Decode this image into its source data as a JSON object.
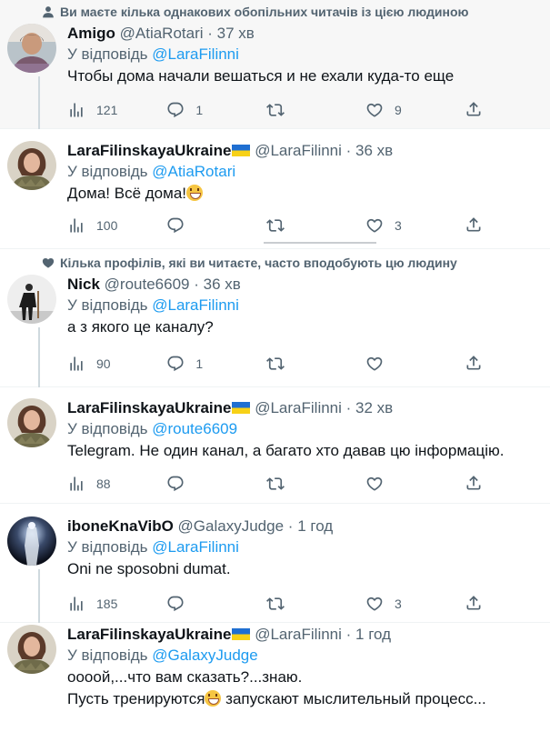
{
  "tweets": [
    {
      "context": "Ви маєте кілька однакових обопільних читачів із цією людиною",
      "name": "Amigo",
      "handle": "@AtiaRotari",
      "time": "37 хв",
      "reply_prefix": "У відповідь",
      "reply_to": "@LaraFilinni",
      "text": "Чтобы дома начали вешаться и не ехали куда-то еще",
      "views": "121",
      "replies": "1",
      "retweets": "",
      "likes": "9"
    },
    {
      "name": "LaraFilinskayaUkraine",
      "handle": "@LaraFilinni",
      "time": "36 хв",
      "reply_prefix": "У відповідь",
      "reply_to": "@AtiaRotari",
      "text": "Дома! Всё дома!",
      "views": "100",
      "replies": "",
      "retweets": "",
      "likes": "3"
    },
    {
      "context": "Кілька профілів, які ви читаєте, часто вподобують цю людину",
      "name": "Nick",
      "handle": "@route6609",
      "time": "36 хв",
      "reply_prefix": "У відповідь",
      "reply_to": "@LaraFilinni",
      "text": "а з якого це каналу?",
      "views": "90",
      "replies": "1",
      "retweets": "",
      "likes": ""
    },
    {
      "name": "LaraFilinskayaUkraine",
      "handle": "@LaraFilinni",
      "time": "32 хв",
      "reply_prefix": "У відповідь",
      "reply_to": "@route6609",
      "text": "Telegram. Не один канал, а багато хто давав цю інформацію.",
      "views": "88",
      "replies": "",
      "retweets": "",
      "likes": ""
    },
    {
      "name": "iboneKnaVibO",
      "handle": "@GalaxyJudge",
      "time": "1 год",
      "reply_prefix": "У відповідь",
      "reply_to": "@LaraFilinni",
      "text": "Oni ne sposobni dumat.",
      "views": "185",
      "replies": "",
      "retweets": "",
      "likes": "3"
    },
    {
      "name": "LaraFilinskayaUkraine",
      "handle": "@LaraFilinni",
      "time": "1 год",
      "reply_prefix": "У відповідь",
      "reply_to": "@GalaxyJudge",
      "text_line1": "оооой,...что вам сказать?...знаю.",
      "text_line2a": "Пусть тренируются",
      "text_line2b": " запускают мыслительный процесс..."
    }
  ],
  "dot": "·",
  "colors": {
    "accent": "#1d9bf0",
    "muted": "#536471",
    "text": "#0f1419"
  }
}
